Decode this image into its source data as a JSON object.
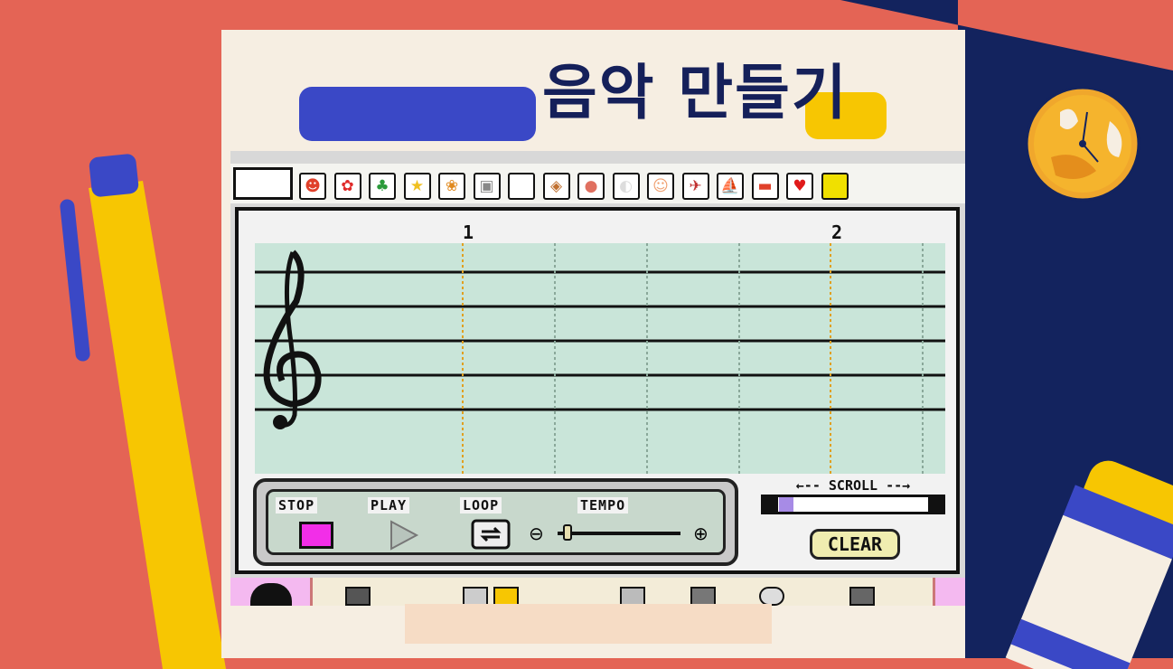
{
  "page": {
    "title": "음악 만들기"
  },
  "colors": {
    "background": "#e46455",
    "navy": "#13235e",
    "card": "#f6eee2",
    "accent_blue": "#3a48c6",
    "accent_yellow": "#f7c602",
    "staff_bg": "#c9e5d9",
    "stop_pink": "#f22ee8"
  },
  "stamp_palette": {
    "items": [
      {
        "icon": "mario-stamp-icon",
        "glyph": "☻"
      },
      {
        "icon": "mushroom-stamp-icon",
        "glyph": "✿"
      },
      {
        "icon": "yoshi-stamp-icon",
        "glyph": "♣"
      },
      {
        "icon": "star-stamp-icon",
        "glyph": "★"
      },
      {
        "icon": "flower-stamp-icon",
        "glyph": "❀"
      },
      {
        "icon": "gameboy-stamp-icon",
        "glyph": "▣"
      },
      {
        "icon": "dog-stamp-icon",
        "glyph": "◆"
      },
      {
        "icon": "cat-stamp-icon",
        "glyph": "◈"
      },
      {
        "icon": "pig-stamp-icon",
        "glyph": "●"
      },
      {
        "icon": "swan-stamp-icon",
        "glyph": "◐"
      },
      {
        "icon": "baby-stamp-icon",
        "glyph": "☺"
      },
      {
        "icon": "plane-stamp-icon",
        "glyph": "✈"
      },
      {
        "icon": "boat-stamp-icon",
        "glyph": "⛵"
      },
      {
        "icon": "car-stamp-icon",
        "glyph": "▬"
      },
      {
        "icon": "heart-stamp-icon",
        "glyph": "♥"
      },
      {
        "icon": "menu-stamp-icon",
        "glyph": "☰"
      }
    ]
  },
  "staff": {
    "measures": [
      "1",
      "2"
    ],
    "clef_icon": "treble-clef-icon"
  },
  "controls": {
    "stop_label": "STOP",
    "play_label": "PLAY",
    "loop_label": "LOOP",
    "tempo_label": "TEMPO",
    "tempo_minus": "⊖",
    "tempo_plus": "⊕"
  },
  "scroll": {
    "label": "←-- SCROLL --→"
  },
  "clear_label": "CLEAR"
}
